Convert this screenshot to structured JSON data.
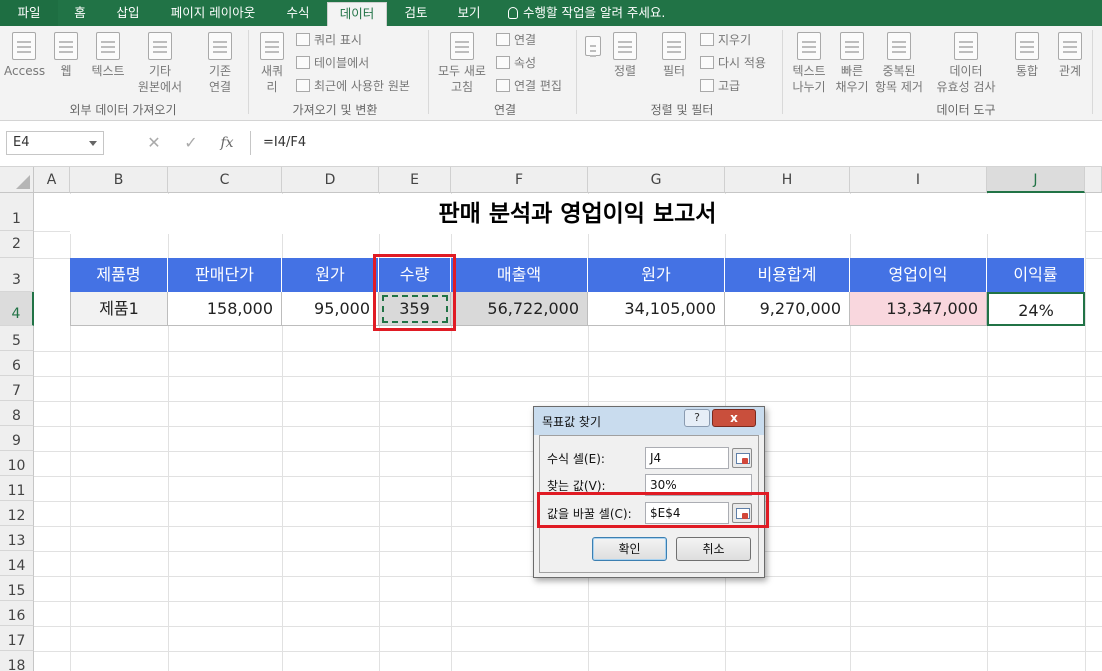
{
  "tabs": [
    "파일",
    "홈",
    "삽입",
    "페이지 레이아웃",
    "수식",
    "데이터",
    "검토",
    "보기"
  ],
  "active_tab": "데이터",
  "tell_me": "수행할 작업을 알려 주세요.",
  "ribbon": {
    "get_external": {
      "access": "Access",
      "web": "웹",
      "text": "텍스트",
      "other_1": "기타",
      "other_2": "원본에서",
      "existing_1": "기존",
      "existing_2": "연결",
      "group": "외부 데이터 가져오기"
    },
    "transform": {
      "new_query_1": "새쿼",
      "new_query_2": "리",
      "show_queries": "쿼리 표시",
      "from_table": "테이블에서",
      "recent_sources": "최근에 사용한 원본",
      "group": "가져오기 및 변환"
    },
    "connections": {
      "refresh_1": "모두 새로",
      "refresh_2": "고침",
      "connections": "연결",
      "properties": "속성",
      "edit_links": "연결 편집",
      "group": "연결"
    },
    "sort_filter": {
      "sort": "정렬",
      "filter": "필터",
      "clear": "지우기",
      "reapply": "다시 적용",
      "advanced": "고급",
      "group": "정렬 및 필터"
    },
    "data_tools": {
      "text_to_cols_1": "텍스트",
      "text_to_cols_2": "나누기",
      "flash_fill_1": "빠른",
      "flash_fill_2": "채우기",
      "remove_dup_1": "중복된",
      "remove_dup_2": "항목 제거",
      "validation_1": "데이터",
      "validation_2": "유효성 검사",
      "consolidate": "통합",
      "relationships": "관계",
      "group": "데이터 도구"
    }
  },
  "formula_bar": {
    "name_box": "E4",
    "cancel": "✕",
    "enter": "✓",
    "fx": "fx",
    "formula": "=I4/F4"
  },
  "columns": [
    "A",
    "B",
    "C",
    "D",
    "E",
    "F",
    "G",
    "H",
    "I",
    "J"
  ],
  "rows": [
    "1",
    "2",
    "3",
    "4",
    "5",
    "6",
    "7",
    "8",
    "9",
    "10",
    "11",
    "12",
    "13",
    "14",
    "15",
    "16",
    "17",
    "18"
  ],
  "sheet": {
    "title": "판매 분석과 영업이익 보고서",
    "headers": [
      "제품명",
      "판매단가",
      "원가",
      "수량",
      "매출액",
      "원가",
      "비용합계",
      "영업이익",
      "이익률"
    ],
    "row4": [
      "제품1",
      "158,000",
      "95,000",
      "359",
      "56,722,000",
      "34,105,000",
      "9,270,000",
      "13,347,000",
      "24%"
    ]
  },
  "dialog": {
    "title": "목표값 찾기",
    "help": "?",
    "close": "x",
    "set_cell_label": "수식 셀(E):",
    "set_cell_value": "J4",
    "to_value_label": "찾는 값(V):",
    "to_value_value": "30%",
    "changing_label": "값을 바꿀 셀(C):",
    "changing_value": "$E$4",
    "ok": "확인",
    "cancel": "취소"
  },
  "colors": {
    "excel_green": "#217346",
    "header_blue": "#4472e4",
    "profit_pink": "#f9d7de",
    "gray_fill": "#d9d9d9",
    "highlight_red": "#e01b24"
  }
}
